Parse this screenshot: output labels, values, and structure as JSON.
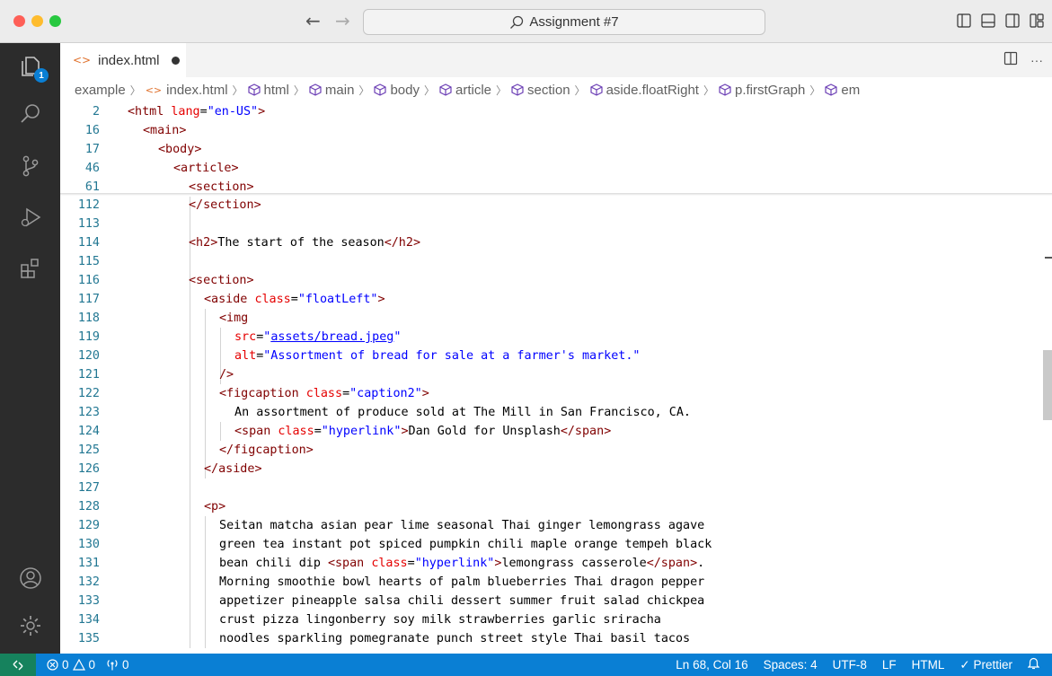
{
  "window": {
    "search_label": "Assignment #7"
  },
  "activity_bar": {
    "top_icons": [
      "explorer-icon",
      "search-icon",
      "source-control-icon",
      "run-debug-icon",
      "extensions-icon"
    ],
    "explorer_badge": "1",
    "bottom_icons": [
      "account-icon",
      "settings-gear-icon"
    ]
  },
  "tab": {
    "filename": "index.html"
  },
  "breadcrumb": {
    "items": [
      "example",
      "index.html",
      "html",
      "main",
      "body",
      "article",
      "section",
      "aside.floatRight",
      "p.firstGraph",
      "em"
    ]
  },
  "editor": {
    "sticky_lines": [
      {
        "num": "2",
        "code": "<html lang=\"en-US\">"
      },
      {
        "num": "16",
        "code": "<main>"
      },
      {
        "num": "17",
        "code": "<body>"
      },
      {
        "num": "46",
        "code": "<article>"
      },
      {
        "num": "61",
        "code": "<section>"
      }
    ],
    "lines": [
      {
        "num": "112",
        "code": "</section>"
      },
      {
        "num": "113",
        "code": ""
      },
      {
        "num": "114",
        "code": "<h2>The start of the season</h2>"
      },
      {
        "num": "115",
        "code": ""
      },
      {
        "num": "116",
        "code": "<section>"
      },
      {
        "num": "117",
        "code": "<aside class=\"floatLeft\">"
      },
      {
        "num": "118",
        "code": "<img"
      },
      {
        "num": "119",
        "code": "src=\"assets/bread.jpeg\""
      },
      {
        "num": "120",
        "code": "alt=\"Assortment of bread for sale at a farmer's market.\""
      },
      {
        "num": "121",
        "code": "/>"
      },
      {
        "num": "122",
        "code": "<figcaption class=\"caption2\">"
      },
      {
        "num": "123",
        "code": "An assortment of produce sold at The Mill in San Francisco, CA."
      },
      {
        "num": "124",
        "code": "<span class=\"hyperlink\">Dan Gold for Unsplash</span>"
      },
      {
        "num": "125",
        "code": "</figcaption>"
      },
      {
        "num": "126",
        "code": "</aside>"
      },
      {
        "num": "127",
        "code": ""
      },
      {
        "num": "128",
        "code": "<p>"
      },
      {
        "num": "129",
        "code": "Seitan matcha asian pear lime seasonal Thai ginger lemongrass agave"
      },
      {
        "num": "130",
        "code": "green tea instant pot spiced pumpkin chili maple orange tempeh black"
      },
      {
        "num": "131",
        "code": "bean chili dip <span class=\"hyperlink\">lemongrass casserole</span>."
      },
      {
        "num": "132",
        "code": "Morning smoothie bowl hearts of palm blueberries Thai dragon pepper"
      },
      {
        "num": "133",
        "code": "appetizer pineapple salsa chili dessert summer fruit salad chickpea"
      },
      {
        "num": "134",
        "code": "crust pizza lingonberry soy milk strawberries garlic sriracha"
      },
      {
        "num": "135",
        "code": "noodles sparkling pomegranate punch street style Thai basil tacos"
      }
    ]
  },
  "status_bar": {
    "errors": "0",
    "warnings": "0",
    "ports": "0",
    "position": "Ln 68, Col 16",
    "spaces": "Spaces: 4",
    "encoding": "UTF-8",
    "eol": "LF",
    "language": "HTML",
    "formatter": "Prettier"
  },
  "colors": {
    "status_bar": "#0a7fd4",
    "remote": "#16825d",
    "activity_bar": "#2c2c2c"
  }
}
